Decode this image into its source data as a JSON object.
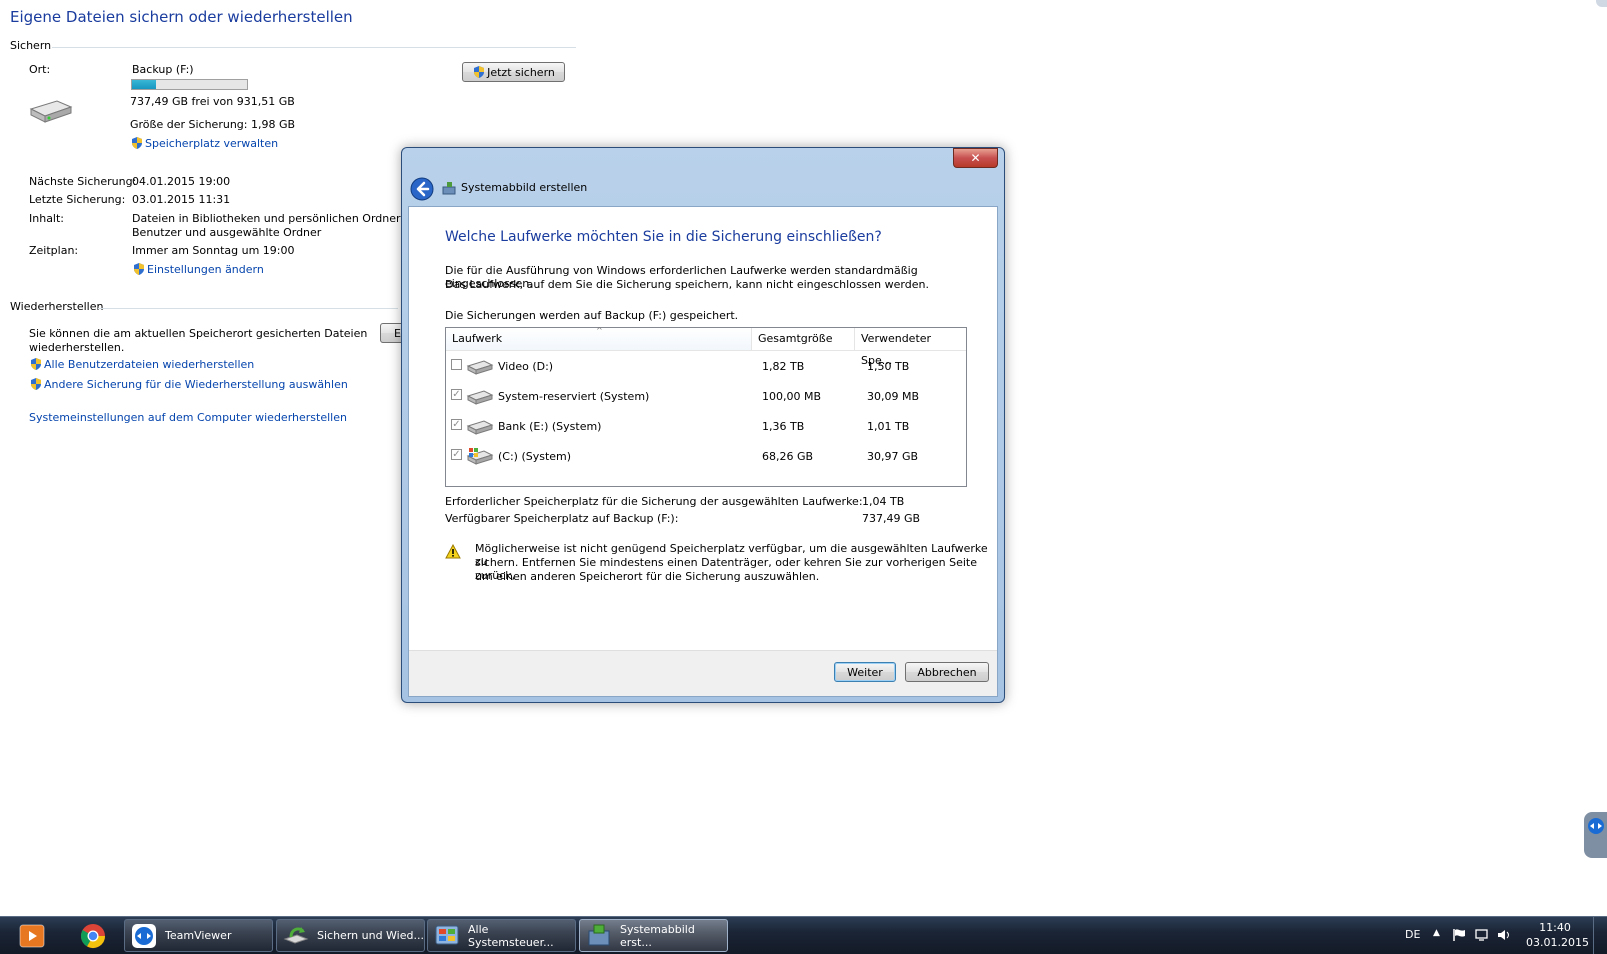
{
  "main": {
    "title": "Eigene Dateien sichern oder wiederherstellen",
    "backup_section": {
      "heading": "Sichern",
      "location_label": "Ort:",
      "location_value": "Backup (F:)",
      "disk_usage_fraction": 0.21,
      "disk_free_text": "737,49 GB frei von 931,51 GB",
      "backup_size_text": "Größe der Sicherung: 1,98 GB",
      "manage_space_link": "Speicherplatz verwalten",
      "backup_now_button": "Jetzt sichern",
      "next_backup_label": "Nächste Sicherung:",
      "next_backup_value": "04.01.2015 19:00",
      "last_backup_label": "Letzte Sicherung:",
      "last_backup_value": "03.01.2015 11:31",
      "content_label": "Inhalt:",
      "content_value_line1": "Dateien in Bibliotheken und persönlichen Ordnern für",
      "content_value_line2": "Benutzer und ausgewählte Ordner",
      "schedule_label": "Zeitplan:",
      "schedule_value": "Immer am Sonntag um 19:00",
      "change_settings_link": "Einstellungen ändern"
    },
    "restore_section": {
      "heading": "Wiederherstellen",
      "description_line1": "Sie können die am aktuellen Speicherort gesicherten Dateien",
      "description_line2": "wiederherstellen.",
      "button_partial": "E",
      "restore_all_link": "Alle Benutzerdateien wiederherstellen",
      "other_backup_link": "Andere Sicherung für die Wiederherstellung auswählen",
      "system_settings_link": "Systemeinstellungen auf dem Computer wiederherstellen"
    }
  },
  "dialog": {
    "window_title": "Systemabbild erstellen",
    "close_glyph": "✕",
    "heading": "Welche Laufwerke möchten Sie in die Sicherung einschließen?",
    "intro_line1": "Die für die Ausführung von Windows erforderlichen Laufwerke werden standardmäßig eingeschlossen.",
    "intro_line2": "Das Laufwerk, auf dem Sie die Sicherung speichern, kann nicht eingeschlossen werden.",
    "saved_to": "Die Sicherungen werden auf Backup (F:) gespeichert.",
    "columns": [
      "Laufwerk",
      "Gesamtgröße",
      "Verwendeter Spe..."
    ],
    "drives": [
      {
        "name": "Video (D:)",
        "total": "1,82 TB",
        "used": "1,50 TB",
        "checked": false,
        "enabled": true,
        "icon": "hard-drive-icon"
      },
      {
        "name": "System-reserviert (System)",
        "total": "100,00 MB",
        "used": "30,09 MB",
        "checked": true,
        "enabled": false,
        "icon": "hard-drive-icon"
      },
      {
        "name": "Bank (E:) (System)",
        "total": "1,36 TB",
        "used": "1,01 TB",
        "checked": true,
        "enabled": false,
        "icon": "hard-drive-icon"
      },
      {
        "name": "(C:) (System)",
        "total": "68,26 GB",
        "used": "30,97 GB",
        "checked": true,
        "enabled": false,
        "icon": "windows-drive-icon"
      }
    ],
    "required_label": "Erforderlicher Speicherplatz für die Sicherung der ausgewählten Laufwerke:",
    "required_value": "1,04 TB",
    "available_label": "Verfügbarer Speicherplatz auf Backup (F:):",
    "available_value": "737,49 GB",
    "warning_line1": "Möglicherweise ist nicht genügend Speicherplatz verfügbar, um die ausgewählten Laufwerke zu",
    "warning_line2": "sichern. Entfernen Sie mindestens einen Datenträger, oder kehren Sie zur vorherigen Seite zurück,",
    "warning_line3": "um einen anderen Speicherort für die Sicherung auszuwählen.",
    "next_button": "Weiter",
    "cancel_button": "Abbrechen"
  },
  "taskbar": {
    "apps": [
      {
        "label": "TeamViewer"
      },
      {
        "label": "Sichern und Wied..."
      },
      {
        "label": "Alle Systemsteuer..."
      },
      {
        "label": "Systemabbild erst..."
      }
    ],
    "language": "DE",
    "time": "11:40",
    "date": "03.01.2015"
  }
}
